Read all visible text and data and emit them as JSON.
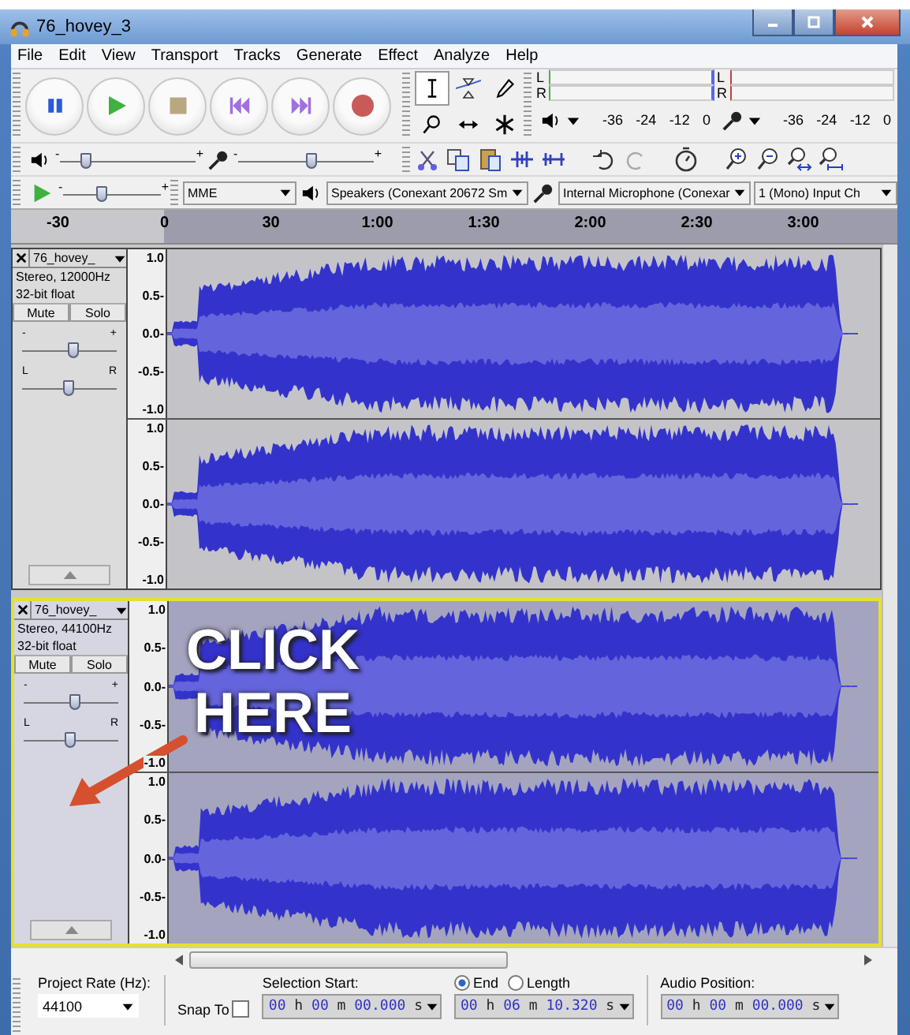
{
  "window": {
    "title": "76_hovey_3"
  },
  "menu": [
    "File",
    "Edit",
    "View",
    "Transport",
    "Tracks",
    "Generate",
    "Effect",
    "Analyze",
    "Help"
  ],
  "meters": [
    {
      "kind": "playback",
      "labels": [
        "L",
        "R"
      ],
      "scale": [
        "-36",
        "-24",
        "-12",
        "0"
      ]
    },
    {
      "kind": "record",
      "labels": [
        "L",
        "R"
      ],
      "scale": [
        "-36",
        "-24",
        "-12",
        "0"
      ]
    }
  ],
  "mixer": {
    "min_label": "-",
    "max_label": "+",
    "playback": {
      "level": 0.2
    },
    "record": {
      "level": 0.55
    }
  },
  "play_at_speed": {
    "min_label": "-",
    "max_label": "+",
    "level": 0.4
  },
  "devices": {
    "host": "MME",
    "output": "Speakers (Conexant 20672 Sm",
    "input": "Internal Microphone (Conexar",
    "channels": "1 (Mono) Input Ch"
  },
  "ruler": [
    "-30",
    "0",
    "30",
    "1:00",
    "1:30",
    "2:00",
    "2:30",
    "3:00"
  ],
  "tracks": [
    {
      "name": "76_hovey_",
      "info": "Stereo, 12000Hz",
      "format": "32-bit float",
      "mute": "Mute",
      "solo": "Solo",
      "selected": false,
      "gain": {
        "min_label": "-",
        "max_label": "+",
        "level": 0.55
      },
      "pan": {
        "left_label": "L",
        "right_label": "R",
        "level": 0.5
      },
      "channels": [
        {
          "scale": [
            "1.0",
            "0.5-",
            "0.0-",
            "-0.5-",
            "-1.0"
          ]
        },
        {
          "scale": [
            "1.0",
            "0.5-",
            "0.0-",
            "-0.5-",
            "-1.0"
          ]
        }
      ]
    },
    {
      "name": "76_hovey_",
      "info": "Stereo, 44100Hz",
      "format": "32-bit float",
      "mute": "Mute",
      "solo": "Solo",
      "selected": true,
      "gain": {
        "min_label": "-",
        "max_label": "+",
        "level": 0.55
      },
      "pan": {
        "left_label": "L",
        "right_label": "R",
        "level": 0.5
      },
      "channels": [
        {
          "scale": [
            "1.0",
            "0.5-",
            "0.0-",
            "-0.5-",
            "-1.0"
          ]
        },
        {
          "scale": [
            "1.0",
            "0.5-",
            "0.0-",
            "-0.5-",
            "-1.0"
          ]
        }
      ]
    }
  ],
  "annotation": {
    "lines": [
      "CLICK",
      "HERE"
    ]
  },
  "selection_toolbar": {
    "project_rate_label": "Project Rate (Hz):",
    "project_rate": "44100",
    "snap_to": "Snap To",
    "snap_checked": false,
    "selection_start_label": "Selection Start:",
    "end_length": [
      {
        "label": "End",
        "selected": true
      },
      {
        "label": "Length",
        "selected": false
      }
    ],
    "audio_position_label": "Audio Position:",
    "times": [
      "00 h 00 m 00.000 s",
      "00 h 06 m 10.320 s",
      "00 h 00 m 00.000 s"
    ]
  }
}
